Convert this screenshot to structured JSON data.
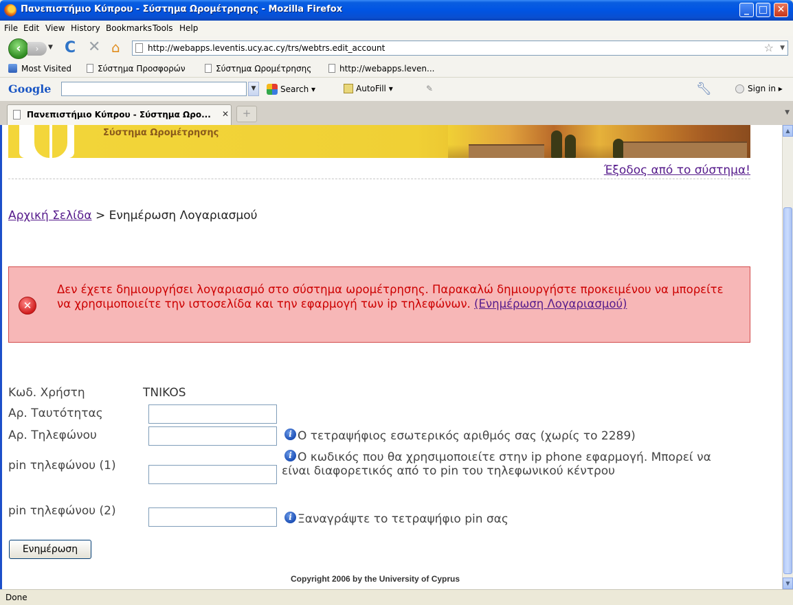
{
  "window": {
    "title": "Πανεπιστήμιο Κύπρου - Σύστημα Ωρομέτρησης - Mozilla Firefox"
  },
  "menu": {
    "items": [
      "File",
      "Edit",
      "View",
      "History",
      "Bookmarks",
      "Tools",
      "Help"
    ]
  },
  "navigation": {
    "url": "http://webapps.leventis.ucy.ac.cy/trs/webtrs.edit_account"
  },
  "bookmarks": {
    "items": [
      "Most Visited",
      "Σύστημα Προσφορών",
      "Σύστημα Ωρομέτρησης",
      "http://webapps.leven..."
    ]
  },
  "google_toolbar": {
    "logo": "Google",
    "search_label": "Search",
    "autofill_label": "AutoFill",
    "signin_label": "Sign in"
  },
  "tabs": {
    "active_label": "Πανεπιστήμιο Κύπρου - Σύστημα Ωρο...",
    "new_tab_symbol": "+"
  },
  "page": {
    "banner_title": "Σύστημα Ωρομέτρησης",
    "logout_link": "Έξοδος από το σύστημα!",
    "breadcrumb": {
      "home_link": "Αρχική Σελίδα",
      "separator": " > ",
      "current": "Ενημέρωση Λογαριασμού"
    },
    "error": {
      "message": "Δεν έχετε δημιουργήσει λογαριασμό στο σύστημα ωρομέτρησης. Παρακαλώ δημιουργήστε προκειμένου να μπορείτε να χρησιμοποιείτε την ιστοσελίδα και την εφαρμογή των ip τηλεφώνων. ",
      "link": "(Ενημέρωση Λογαριασμού)"
    },
    "form": {
      "user_code_label": "Κωδ. Χρήστη",
      "user_code_value": "TNIKOS",
      "id_label": "Αρ. Ταυτότητας",
      "id_value": "",
      "phone_label": "Αρ. Τηλεφώνου",
      "phone_value": "",
      "phone_hint": "Ο τετραψήφιος εσωτερικός αριθμός σας (χωρίς το 2289)",
      "pin1_label": "pin τηλεφώνου (1)",
      "pin1_value": "",
      "pin1_hint": "Ο κωδικός που θα χρησιμοποιείτε στην ip phone εφαρμογή. Μπορεί να είναι διαφορετικός από το pin του τηλεφωνικού κέντρου",
      "pin2_label": "pin τηλεφώνου (2)",
      "pin2_value": "",
      "pin2_hint": "Ξαναγράψτε το τετραψήφιο pin σας",
      "submit_label": "Ενημέρωση"
    },
    "copyright": "Copyright 2006 by the University of Cyprus"
  },
  "status": {
    "text": "Done"
  }
}
